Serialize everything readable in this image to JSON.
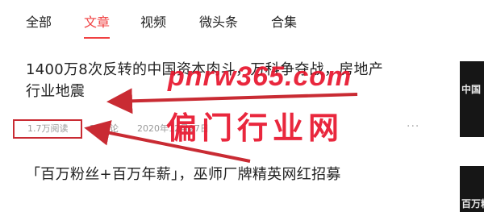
{
  "tabs": [
    {
      "label": "全部",
      "active": false
    },
    {
      "label": "文章",
      "active": true
    },
    {
      "label": "视频",
      "active": false
    },
    {
      "label": "微头条",
      "active": false
    },
    {
      "label": "合集",
      "active": false
    }
  ],
  "articles": [
    {
      "title_line1": "1400万8次反转的中国资本肉斗，万科争夺战，房地产",
      "title_line2": "行业地震",
      "views": "1.7万阅读",
      "comments": "30评论",
      "date": "2020年12月27日",
      "more_icon": "···",
      "thumb_text": "中国 万"
    },
    {
      "title_line1": "「百万粉丝+百万年薪」，巫师厂牌精英网红招募",
      "thumb_text": "百万粉"
    }
  ],
  "watermark": {
    "url": "pnrw365.com",
    "text": "偏门行业网"
  },
  "colors": {
    "accent": "#f04142",
    "highlight_box": "#c92b33",
    "watermark": "#e8152d"
  }
}
